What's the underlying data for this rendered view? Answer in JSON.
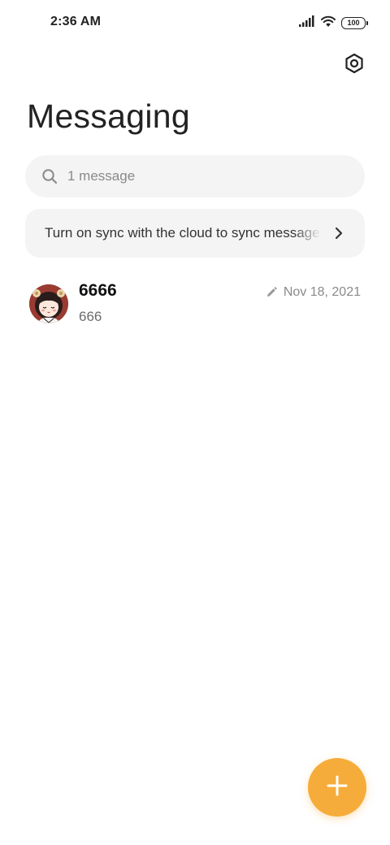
{
  "status_bar": {
    "time": "2:36 AM",
    "battery_level": "100",
    "icons": [
      "signal-icon",
      "wifi-icon",
      "battery-icon"
    ]
  },
  "header": {
    "title": "Messaging",
    "settings_icon": "settings-icon"
  },
  "search": {
    "placeholder": "1 message",
    "value": "",
    "icon": "search-icon"
  },
  "sync_banner": {
    "text": "Turn on sync with the cloud to sync messages",
    "icon": "chevron-right-icon"
  },
  "conversations": [
    {
      "name": "6666",
      "preview": "666",
      "date": "Nov 18, 2021",
      "is_draft": true,
      "avatar": "avatar-illustration"
    }
  ],
  "fab": {
    "icon": "plus-icon",
    "color": "#f6ac3a"
  },
  "colors": {
    "accent": "#f6ac3a",
    "surface": "#f4f4f4",
    "background": "#ffffff"
  }
}
